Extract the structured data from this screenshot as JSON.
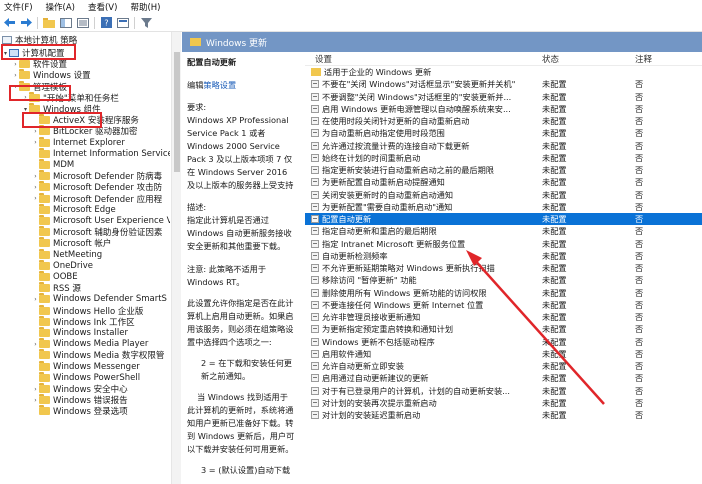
{
  "menu": [
    "文件(F)",
    "操作(A)",
    "查看(V)",
    "帮助(H)"
  ],
  "tree": {
    "root": "本地计算机 策略",
    "items": [
      {
        "label": "计算机配置",
        "indent": 0,
        "type": "pc",
        "arrow": "▾"
      },
      {
        "label": "软件设置",
        "indent": 1,
        "type": "folder",
        "arrow": "›"
      },
      {
        "label": "Windows 设置",
        "indent": 1,
        "type": "folder",
        "arrow": "›"
      },
      {
        "label": "管理模板",
        "indent": 1,
        "type": "folder",
        "arrow": "▾"
      },
      {
        "label": "\"开始\"菜单和任务栏",
        "indent": 2,
        "type": "folder",
        "arrow": "›"
      },
      {
        "label": "Windows 组件",
        "indent": 2,
        "type": "folder",
        "arrow": "▾"
      },
      {
        "label": "ActiveX 安装程序服务",
        "indent": 3,
        "type": "folder",
        "arrow": ""
      },
      {
        "label": "BitLocker 驱动器加密",
        "indent": 3,
        "type": "folder",
        "arrow": "›"
      },
      {
        "label": "Internet Explorer",
        "indent": 3,
        "type": "folder",
        "arrow": "›"
      },
      {
        "label": "Internet Information Service",
        "indent": 3,
        "type": "folder",
        "arrow": ""
      },
      {
        "label": "MDM",
        "indent": 3,
        "type": "folder",
        "arrow": ""
      },
      {
        "label": "Microsoft Defender 防病毒",
        "indent": 3,
        "type": "folder",
        "arrow": "›"
      },
      {
        "label": "Microsoft Defender 攻击防",
        "indent": 3,
        "type": "folder",
        "arrow": "›"
      },
      {
        "label": "Microsoft Defender 应用程",
        "indent": 3,
        "type": "folder",
        "arrow": "›"
      },
      {
        "label": "Microsoft Edge",
        "indent": 3,
        "type": "folder",
        "arrow": ""
      },
      {
        "label": "Microsoft User Experience V",
        "indent": 3,
        "type": "folder",
        "arrow": ""
      },
      {
        "label": "Microsoft 辅助身份验证因素",
        "indent": 3,
        "type": "folder",
        "arrow": ""
      },
      {
        "label": "Microsoft 帐户",
        "indent": 3,
        "type": "folder",
        "arrow": ""
      },
      {
        "label": "NetMeeting",
        "indent": 3,
        "type": "folder",
        "arrow": ""
      },
      {
        "label": "OneDrive",
        "indent": 3,
        "type": "folder",
        "arrow": ""
      },
      {
        "label": "OOBE",
        "indent": 3,
        "type": "folder",
        "arrow": ""
      },
      {
        "label": "RSS 源",
        "indent": 3,
        "type": "folder",
        "arrow": ""
      },
      {
        "label": "Windows Defender SmartS",
        "indent": 3,
        "type": "folder",
        "arrow": "›"
      },
      {
        "label": "Windows Hello 企业版",
        "indent": 3,
        "type": "folder",
        "arrow": ""
      },
      {
        "label": "Windows Ink 工作区",
        "indent": 3,
        "type": "folder",
        "arrow": ""
      },
      {
        "label": "Windows Installer",
        "indent": 3,
        "type": "folder",
        "arrow": ""
      },
      {
        "label": "Windows Media Player",
        "indent": 3,
        "type": "folder",
        "arrow": "›"
      },
      {
        "label": "Windows Media 数字权限管",
        "indent": 3,
        "type": "folder",
        "arrow": ""
      },
      {
        "label": "Windows Messenger",
        "indent": 3,
        "type": "folder",
        "arrow": ""
      },
      {
        "label": "Windows PowerShell",
        "indent": 3,
        "type": "folder",
        "arrow": ""
      },
      {
        "label": "Windows 安全中心",
        "indent": 3,
        "type": "folder",
        "arrow": "›"
      },
      {
        "label": "Windows 错误报告",
        "indent": 3,
        "type": "folder",
        "arrow": "›"
      },
      {
        "label": "Windows 登录选项",
        "indent": 3,
        "type": "folder",
        "arrow": ""
      }
    ]
  },
  "header": {
    "title": "Windows 更新"
  },
  "description": {
    "title": "配置自动更新",
    "edit_prefix": "编辑",
    "edit_link": "策略设置",
    "req_label": "要求:",
    "req_text": "Windows XP Professional Service Pack 1 或者 Windows 2000 Service Pack 3 及以上版本项项 7 仅在 Windows Server 2016 及以上版本的服务器上受支持",
    "desc_label": "描述:",
    "desc_text": "指定此计算机是否通过 Windows 自动更新服务接收安全更新和其他重要下载。",
    "note": "注意: 此策略不适用于 Windows RT。",
    "para1": "此设置允许你指定是否在此计算机上启用自动更新。如果启用该服务，则必须在组策略设置中选择四个选项之一:",
    "para2": "2 = 在下载和安装任何更新之前通知。",
    "para3": "当 Windows 找到适用于此计算机的更新时，系统将通知用户更新已准备好下载。转到 Windows 更新后，用户可以下载并安装任何可用更新。",
    "para4": "3 = (默认设置)自动下载"
  },
  "columns": {
    "setting": "设置",
    "state": "状态",
    "comment": "注释"
  },
  "rows": [
    {
      "name": "适用于企业的 Windows 更新",
      "state": "",
      "comment": "",
      "folder": true
    },
    {
      "name": "不要在\"关闭 Windows\"对话框显示\"安装更新并关机\"",
      "state": "未配置",
      "comment": "否"
    },
    {
      "name": "不要调整\"关闭 Windows\"对话框里的\"安装更新并...",
      "state": "未配置",
      "comment": "否"
    },
    {
      "name": "启用 Windows 更新电源管理以自动唤醒系统来安...",
      "state": "未配置",
      "comment": "否"
    },
    {
      "name": "在使用时段关闭针对更新的自动重新启动",
      "state": "未配置",
      "comment": "否"
    },
    {
      "name": "为自动重新启动指定使用时段范围",
      "state": "未配置",
      "comment": "否"
    },
    {
      "name": "允许通过按流量计费的连接自动下载更新",
      "state": "未配置",
      "comment": "否"
    },
    {
      "name": "始终在计划的时间重新启动",
      "state": "未配置",
      "comment": "否"
    },
    {
      "name": "指定更新安装进行自动重新启动之前的最后期限",
      "state": "未配置",
      "comment": "否"
    },
    {
      "name": "为更新配置自动重新启动提醒通知",
      "state": "未配置",
      "comment": "否"
    },
    {
      "name": "关闭安装更新时的自动重新启动通知",
      "state": "未配置",
      "comment": "否"
    },
    {
      "name": "为更新配置\"需要自动重新启动\"通知",
      "state": "未配置",
      "comment": "否"
    },
    {
      "name": "配置自动更新",
      "state": "未配置",
      "comment": "否",
      "selected": true
    },
    {
      "name": "指定自动更新和重启的最后期限",
      "state": "未配置",
      "comment": "否"
    },
    {
      "name": "指定 Intranet Microsoft 更新服务位置",
      "state": "未配置",
      "comment": "否"
    },
    {
      "name": "自动更新检测频率",
      "state": "未配置",
      "comment": "否"
    },
    {
      "name": "不允许更新延期策略对 Windows 更新执行扫描",
      "state": "未配置",
      "comment": "否"
    },
    {
      "name": "移除访问 \"暂停更新\" 功能",
      "state": "未配置",
      "comment": "否"
    },
    {
      "name": "删除使用所有 Windows 更新功能的访问权限",
      "state": "未配置",
      "comment": "否"
    },
    {
      "name": "不要连接任何 Windows 更新 Internet 位置",
      "state": "未配置",
      "comment": "否"
    },
    {
      "name": "允许非管理员接收更新通知",
      "state": "未配置",
      "comment": "否"
    },
    {
      "name": "为更新指定预定重启转换和通知计划",
      "state": "未配置",
      "comment": "否"
    },
    {
      "name": "Windows 更新不包括驱动程序",
      "state": "未配置",
      "comment": "否"
    },
    {
      "name": "启用软件通知",
      "state": "未配置",
      "comment": "否"
    },
    {
      "name": "允许自动更新立即安装",
      "state": "未配置",
      "comment": "否"
    },
    {
      "name": "启用通过自动更新建议的更新",
      "state": "未配置",
      "comment": "否"
    },
    {
      "name": "对于有已登录用户的计算机，计划的自动更新安装...",
      "state": "未配置",
      "comment": "否"
    },
    {
      "name": "对计划的安装再次提示重新启动",
      "state": "未配置",
      "comment": "否"
    },
    {
      "name": "对计划的安装延迟重新启动",
      "state": "未配置",
      "comment": "否"
    }
  ]
}
